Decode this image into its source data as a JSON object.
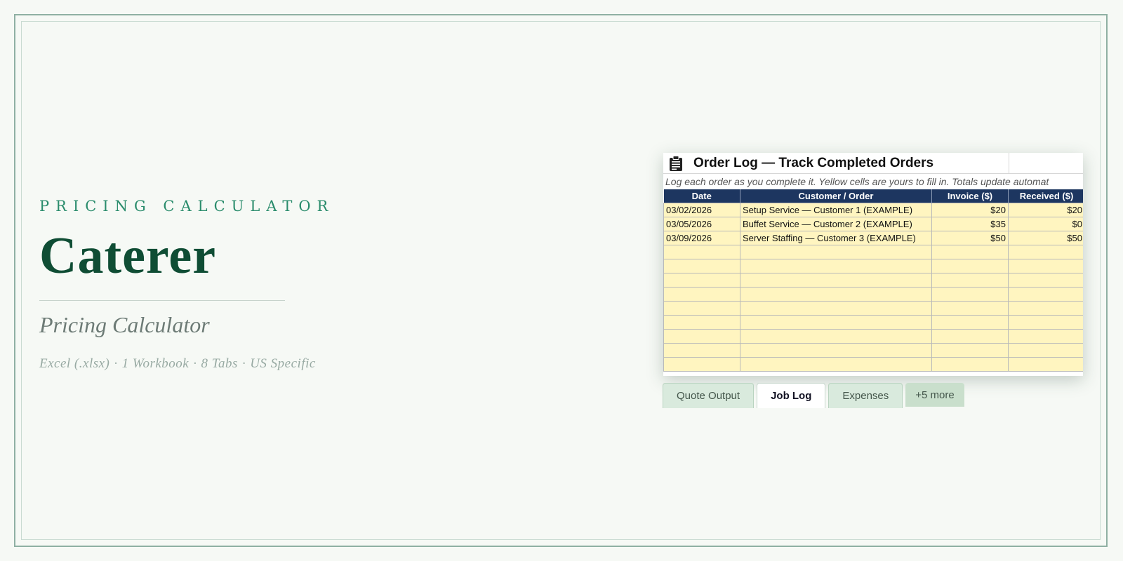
{
  "hero": {
    "eyebrow": "PRICING CALCULATOR",
    "title": "Caterer",
    "subtitle": "Pricing Calculator",
    "meta": [
      "Excel (.xlsx)",
      "1 Workbook",
      "8 Tabs",
      "US Specific"
    ]
  },
  "sheet": {
    "icon": "clipboard-icon",
    "title": "Order Log — Track Completed Orders",
    "subtitle": "Log each order as you complete it. Yellow cells are yours to fill in. Totals update automat",
    "columns": [
      "Date",
      "Customer / Order",
      "Invoice ($)",
      "Received ($)"
    ],
    "rows": [
      [
        "03/02/2026",
        "Setup Service — Customer 1 (EXAMPLE)",
        "$20",
        "$20"
      ],
      [
        "03/05/2026",
        "Buffet Service — Customer 2 (EXAMPLE)",
        "$35",
        "$0"
      ],
      [
        "03/09/2026",
        "Server Staffing — Customer 3 (EXAMPLE)",
        "$50",
        "$50"
      ],
      [
        "",
        "",
        "",
        ""
      ],
      [
        "",
        "",
        "",
        ""
      ],
      [
        "",
        "",
        "",
        ""
      ],
      [
        "",
        "",
        "",
        ""
      ],
      [
        "",
        "",
        "",
        ""
      ],
      [
        "",
        "",
        "",
        ""
      ],
      [
        "",
        "",
        "",
        ""
      ],
      [
        "",
        "",
        "",
        ""
      ],
      [
        "",
        "",
        "",
        ""
      ]
    ]
  },
  "tabs": [
    {
      "label": "Quote Output",
      "active": false
    },
    {
      "label": "Job Log",
      "active": true
    },
    {
      "label": "Expenses",
      "active": false
    }
  ],
  "more_tabs_label": "+5 more",
  "colors": {
    "brand_green": "#0f4d34",
    "accent_teal": "#2a8c6c",
    "header_navy": "#1d3660",
    "input_yellow": "#fff5c0"
  }
}
